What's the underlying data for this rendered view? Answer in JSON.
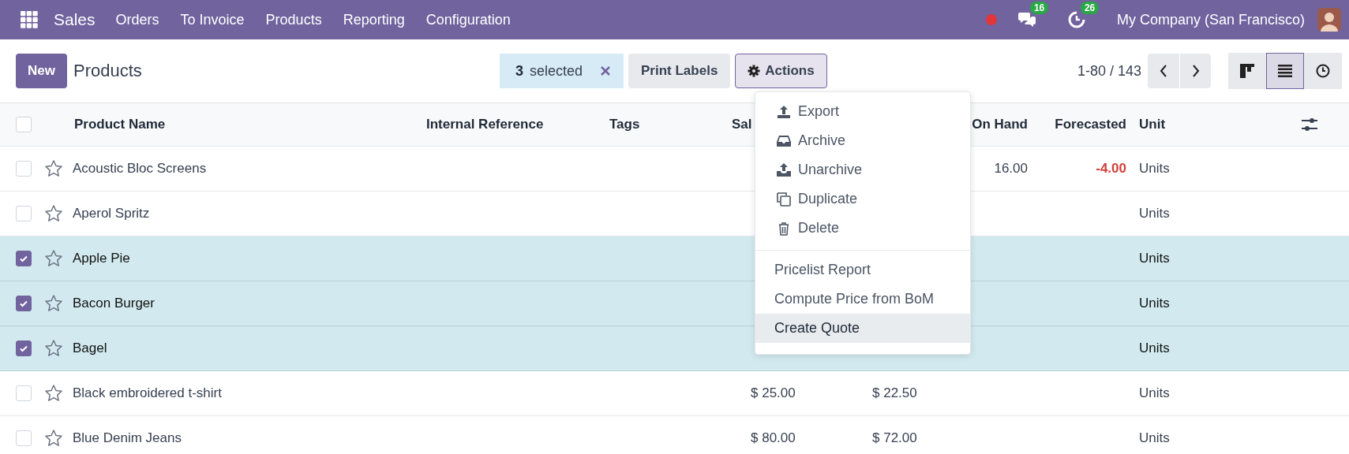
{
  "navbar": {
    "app": "Sales",
    "menu": [
      "Orders",
      "To Invoice",
      "Products",
      "Reporting",
      "Configuration"
    ],
    "badges": [
      {
        "kind": "chat",
        "count": "16"
      },
      {
        "kind": "activity",
        "count": "26"
      }
    ],
    "company": "My Company (San Francisco)"
  },
  "control_panel": {
    "new_button": "New",
    "title": "Products",
    "selection": {
      "count": "3",
      "label": "selected"
    },
    "print_button": "Print Labels",
    "actions": {
      "label": "Actions",
      "expanded": true
    },
    "pager": "1-80 / 143",
    "views": [
      {
        "kind": "kanban",
        "selected": false
      },
      {
        "kind": "list",
        "selected": true
      },
      {
        "kind": "activity",
        "selected": false
      }
    ]
  },
  "actions_menu": {
    "groups": [
      [
        {
          "kind": "export",
          "label": "Export",
          "highlighted": false
        },
        {
          "kind": "archive",
          "label": "Archive",
          "highlighted": false
        },
        {
          "kind": "unarchive",
          "label": "Unarchive",
          "highlighted": false
        },
        {
          "kind": "duplicate",
          "label": "Duplicate",
          "highlighted": false
        },
        {
          "kind": "delete",
          "label": "Delete",
          "highlighted": false
        }
      ],
      [
        {
          "kind": "plain",
          "label": "Pricelist Report",
          "highlighted": false
        },
        {
          "kind": "plain",
          "label": "Compute Price from BoM",
          "highlighted": false
        },
        {
          "kind": "plain",
          "label": "Create Quote",
          "highlighted": true
        }
      ]
    ]
  },
  "table": {
    "select_all": {
      "checked": false
    },
    "columns": [
      "Product Name",
      "Internal Reference",
      "Tags",
      "Sal",
      "On Hand",
      "Forecasted",
      "Unit"
    ],
    "rows": [
      {
        "selected": false,
        "favorite": false,
        "name": "Acoustic Bloc Screens",
        "on_hand": "16.00",
        "forecasted": "-4.00",
        "forecasted_alert": true,
        "unit": "Units"
      },
      {
        "selected": false,
        "favorite": false,
        "name": "Aperol Spritz",
        "unit": "Units"
      },
      {
        "selected": true,
        "favorite": false,
        "name": "Apple Pie",
        "unit": "Units"
      },
      {
        "selected": true,
        "favorite": false,
        "name": "Bacon Burger",
        "unit": "Units"
      },
      {
        "selected": true,
        "favorite": false,
        "name": "Bagel",
        "unit": "Units"
      },
      {
        "selected": false,
        "favorite": false,
        "name": "Black embroidered t-shirt",
        "sales_price": "$ 25.00",
        "cost": "$ 22.50",
        "unit": "Units"
      },
      {
        "selected": false,
        "favorite": false,
        "name": "Blue Denim Jeans",
        "sales_price": "$ 80.00",
        "cost": "$ 72.00",
        "unit": "Units"
      }
    ]
  }
}
